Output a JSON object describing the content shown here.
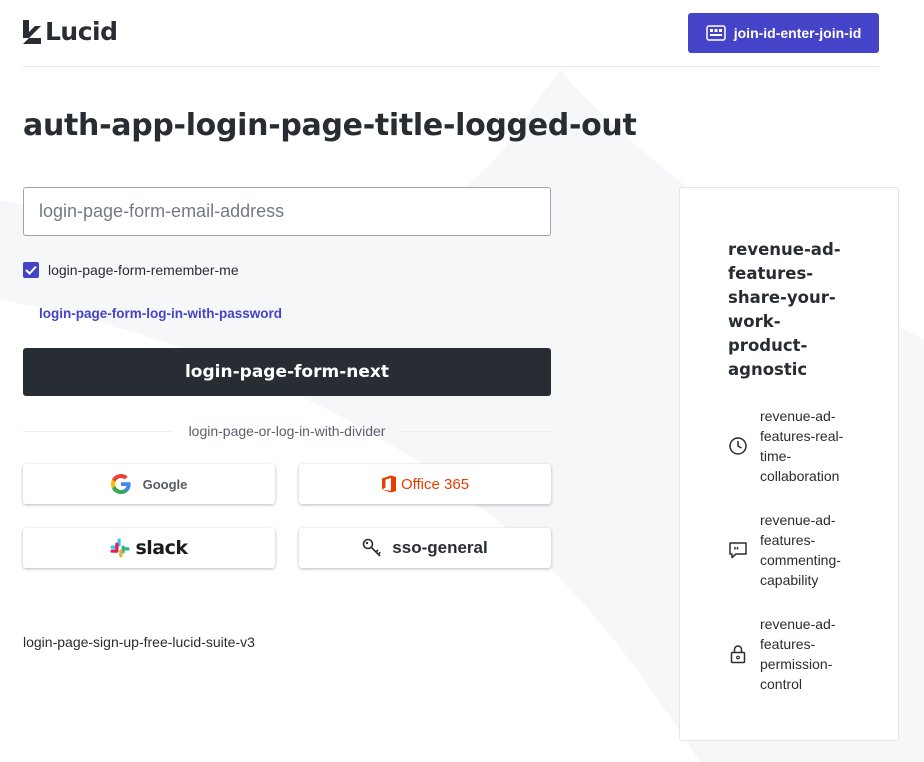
{
  "header": {
    "logo_text": "Lucid",
    "join_button_label": "join-id-enter-join-id"
  },
  "page": {
    "title": "auth-app-login-page-title-logged-out"
  },
  "form": {
    "email_placeholder": "login-page-form-email-address",
    "email_value": "",
    "remember_me_label": "login-page-form-remember-me",
    "remember_me_checked": true,
    "password_link": "login-page-form-log-in-with-password",
    "next_button_label": "login-page-form-next",
    "divider_text": "login-page-or-log-in-with-divider"
  },
  "sso": {
    "google_label": "Google",
    "office_label": "Office 365",
    "slack_label": "slack",
    "general_label": "sso-general"
  },
  "footer": {
    "signup_text": "login-page-sign-up-free-lucid-suite-v3"
  },
  "card": {
    "title": "revenue-ad-features-share-your-work-product-agnostic",
    "features": [
      {
        "icon": "clock-icon",
        "text": "revenue-ad-features-real-time-collaboration"
      },
      {
        "icon": "comment-icon",
        "text": "revenue-ad-features-commenting-capability"
      },
      {
        "icon": "lock-icon",
        "text": "revenue-ad-features-permission-control"
      }
    ]
  },
  "colors": {
    "brand_primary": "#4543c7",
    "dark_button": "#282c33",
    "office_red": "#eb3c00"
  }
}
